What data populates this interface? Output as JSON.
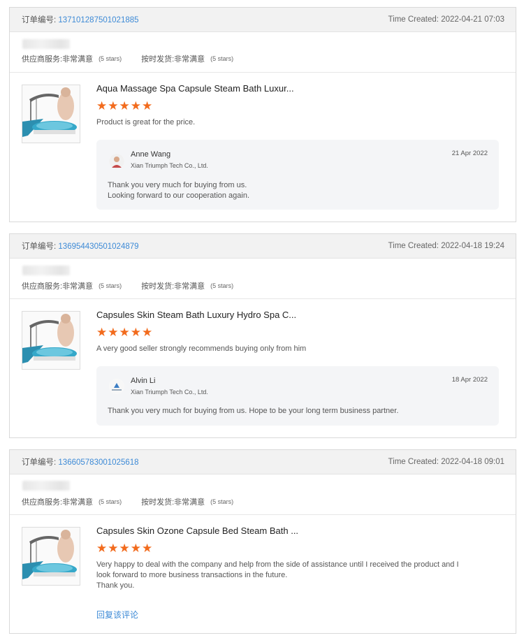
{
  "labels": {
    "order_no": "订单编号:",
    "time_created": "Time Created:",
    "supplier_service": "供应商服务:",
    "on_time_delivery": "按时发货:",
    "very_satisfied": "非常满意",
    "five_stars": "(5 stars)",
    "stars_glyph": "★★★★★"
  },
  "colors": {
    "accent_link": "#3d8ad6",
    "star": "#f26b1d"
  },
  "reviews": [
    {
      "order_number": "137101287501021885",
      "time_created": "2022-04-21 07:03",
      "product_title": "Aqua Massage Spa Capsule Steam Bath Luxur...",
      "rating": 5,
      "review_text": "Product is great for the price.",
      "reply": {
        "name": "Anne Wang",
        "company": "Xian Triumph Tech Co., Ltd.",
        "date": "21 Apr 2022",
        "message_lines": [
          "Thank you very much for buying from us.",
          "Looking forward to our cooperation again."
        ]
      }
    },
    {
      "order_number": "136954430501024879",
      "time_created": "2022-04-18 19:24",
      "product_title": "Capsules Skin Steam Bath Luxury Hydro Spa C...",
      "rating": 5,
      "review_text": "A very good seller strongly recommends buying only from him",
      "reply": {
        "name": "Alvin Li",
        "company": "Xian Triumph Tech Co., Ltd.",
        "date": "18 Apr 2022",
        "message_lines": [
          "Thank you very much for buying from us. Hope to  be your long term business partner."
        ]
      }
    },
    {
      "order_number": "136605783001025618",
      "time_created": "2022-04-18 09:01",
      "product_title": "Capsules Skin Ozone Capsule Bed Steam Bath ...",
      "rating": 5,
      "review_text_lines": [
        "Very happy to deal with the company and help from the side of assistance until I received the product and I",
        "look forward to more business transactions in the future.",
        "Thank you."
      ],
      "reply_link": "回复该评论"
    }
  ]
}
